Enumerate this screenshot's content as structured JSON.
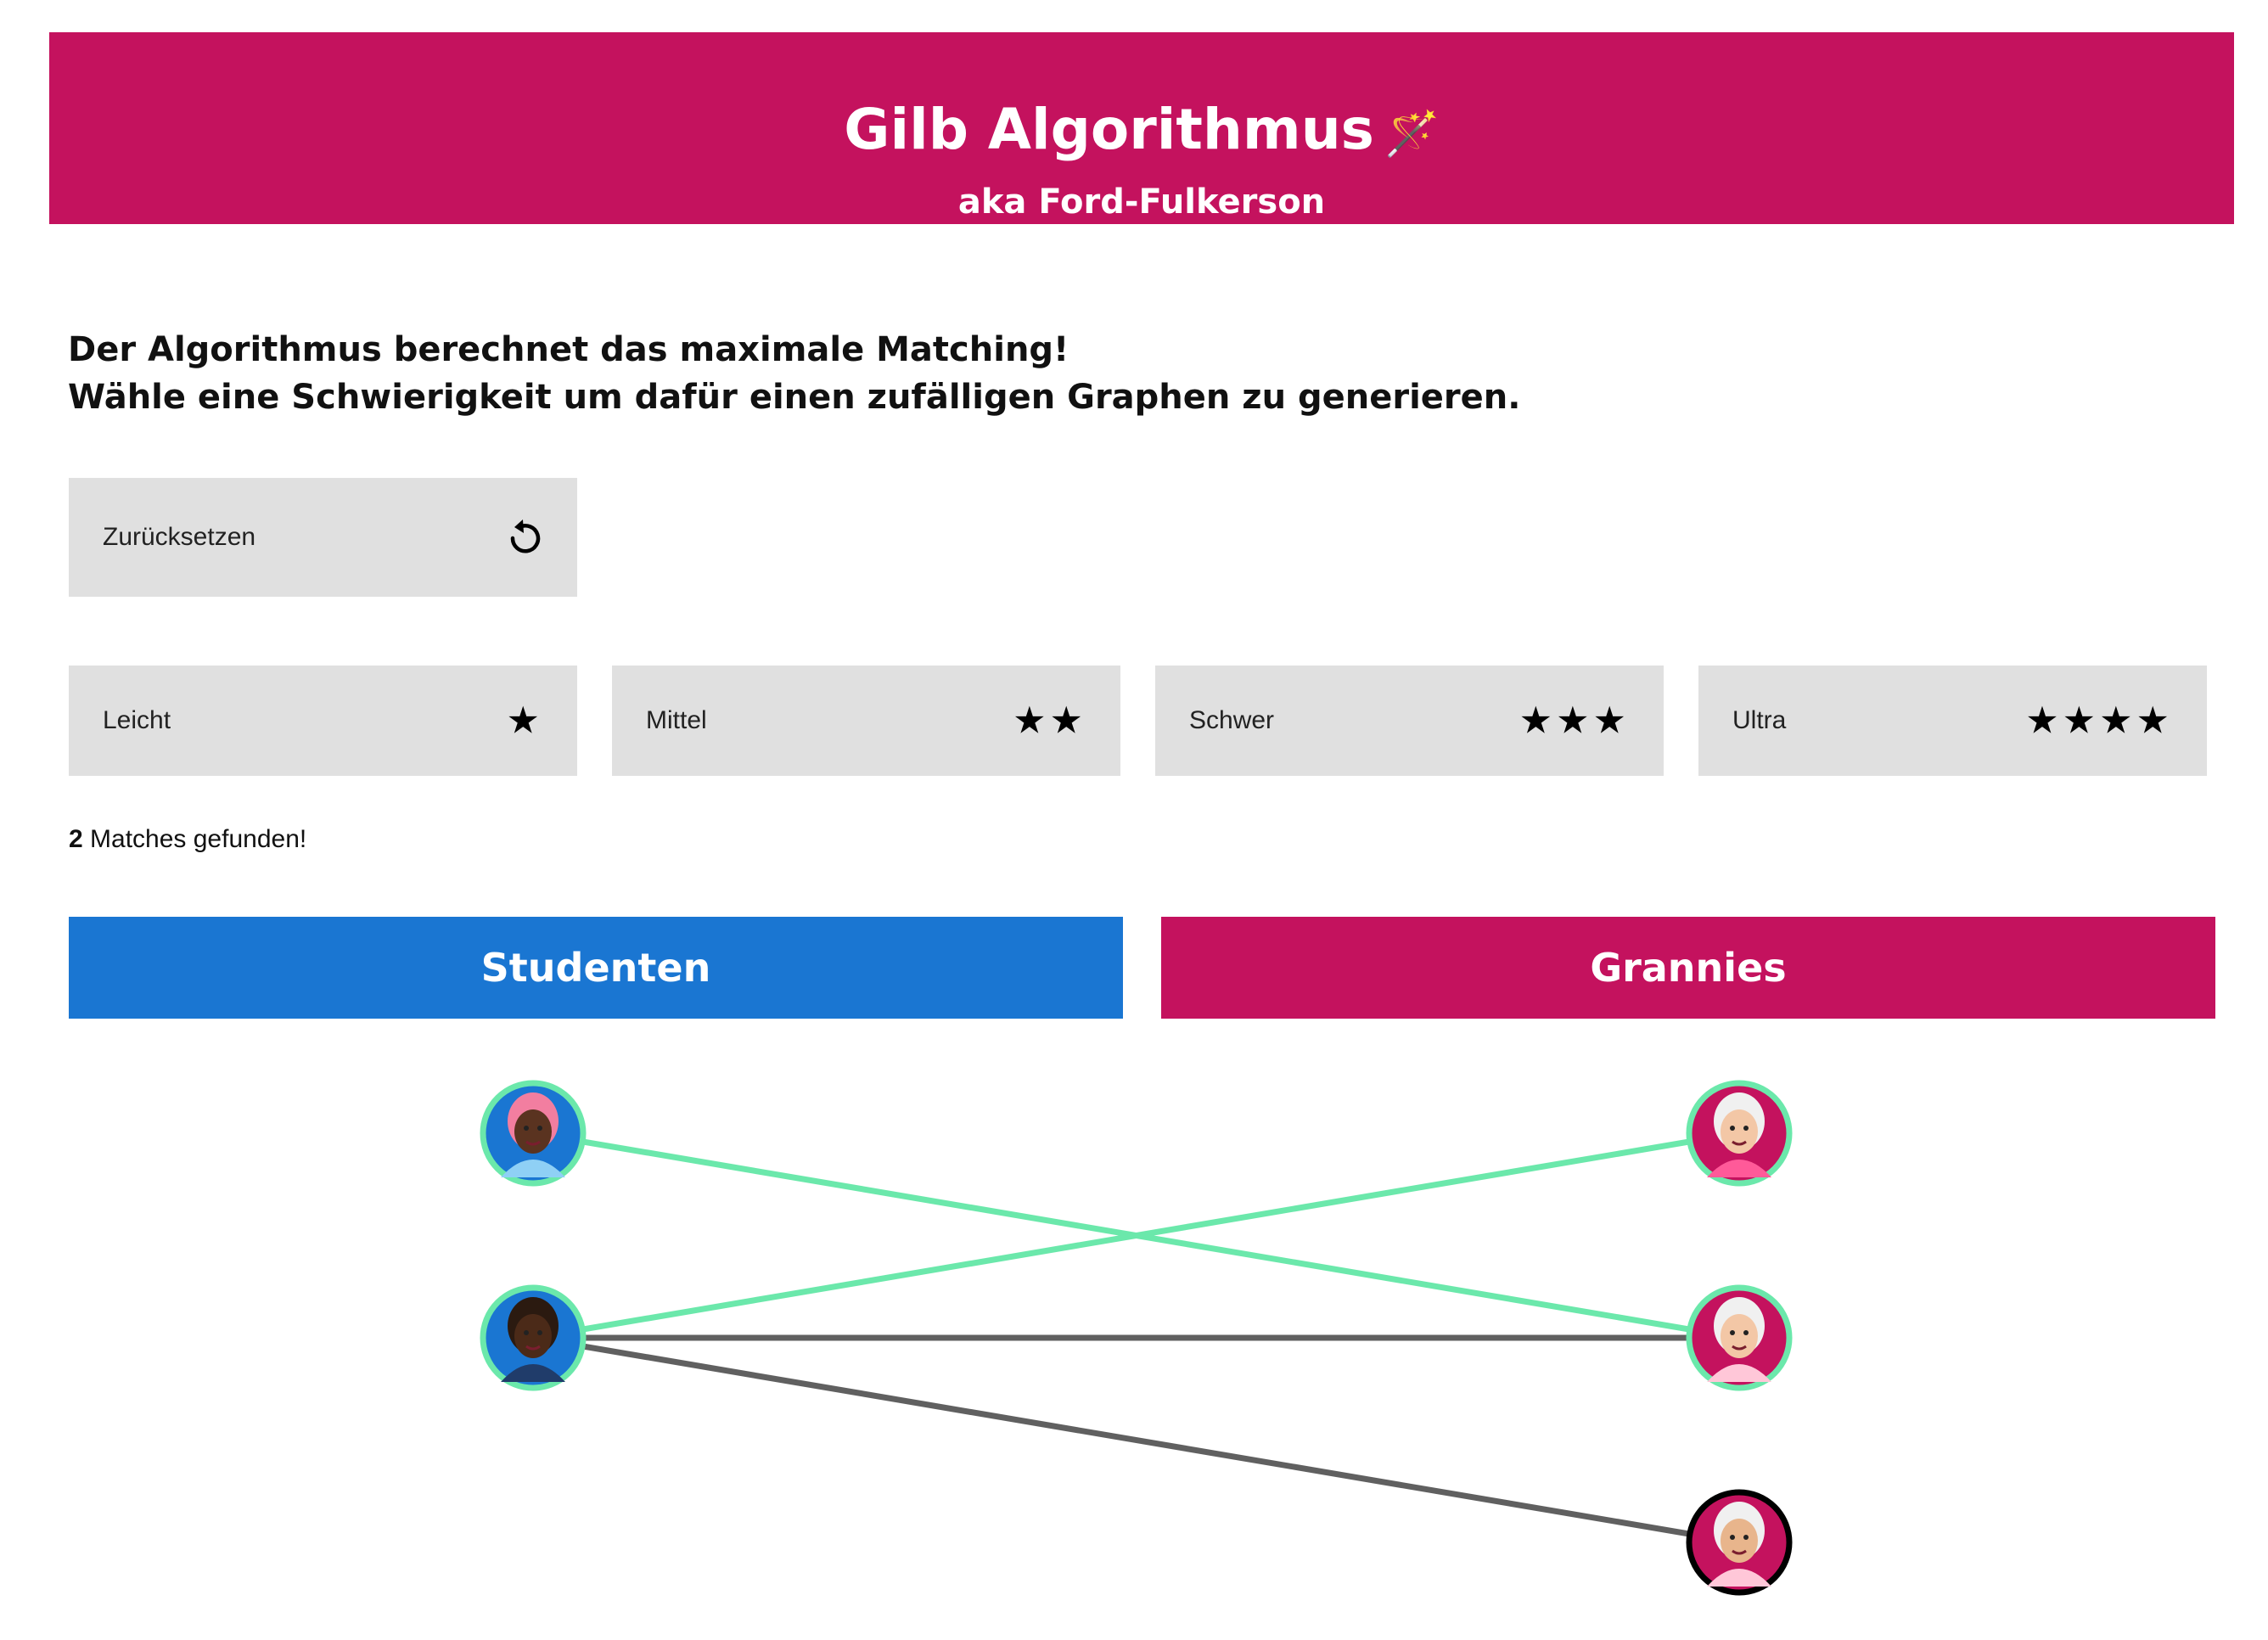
{
  "header": {
    "title": "Gilb Algorithmus",
    "title_icon": "magic-wand-icon",
    "subtitle": "aka Ford-Fulkerson"
  },
  "intro": {
    "line1": "Der Algorithmus berechnet das maximale Matching!",
    "line2": "Wähle eine Schwierigkeit um dafür einen zufälligen Graphen zu generieren."
  },
  "reset_button": {
    "label": "Zurücksetzen",
    "icon": "reset-icon"
  },
  "difficulties": [
    {
      "label": "Leicht",
      "stars": "★"
    },
    {
      "label": "Mittel",
      "stars": "★★"
    },
    {
      "label": "Schwer",
      "stars": "★★★"
    },
    {
      "label": "Ultra",
      "stars": "★★★★"
    }
  ],
  "result": {
    "count": "2",
    "text": "Matches gefunden!"
  },
  "columns": {
    "left": "Studenten",
    "right": "Grannies"
  },
  "colors": {
    "brand_pink": "#c4125e",
    "brand_blue": "#1a76d2",
    "matched_edge": "#6be8ab",
    "unmatched_edge": "#606060",
    "button_bg": "#e0e0e0"
  },
  "graph": {
    "students": [
      {
        "avatar": "student-avatar-pink-hair",
        "matched": true
      },
      {
        "avatar": "student-avatar-resist-shirt",
        "matched": true
      }
    ],
    "grannies": [
      {
        "avatar": "granny-avatar-pink-shirt",
        "matched": true
      },
      {
        "avatar": "granny-avatar-crying",
        "matched": true
      },
      {
        "avatar": "granny-avatar-unmatched",
        "matched": false
      }
    ],
    "edges": [
      {
        "from": 0,
        "to": 1,
        "matched": true
      },
      {
        "from": 1,
        "to": 0,
        "matched": true
      },
      {
        "from": 1,
        "to": 1,
        "matched": false
      },
      {
        "from": 1,
        "to": 2,
        "matched": false
      }
    ]
  }
}
